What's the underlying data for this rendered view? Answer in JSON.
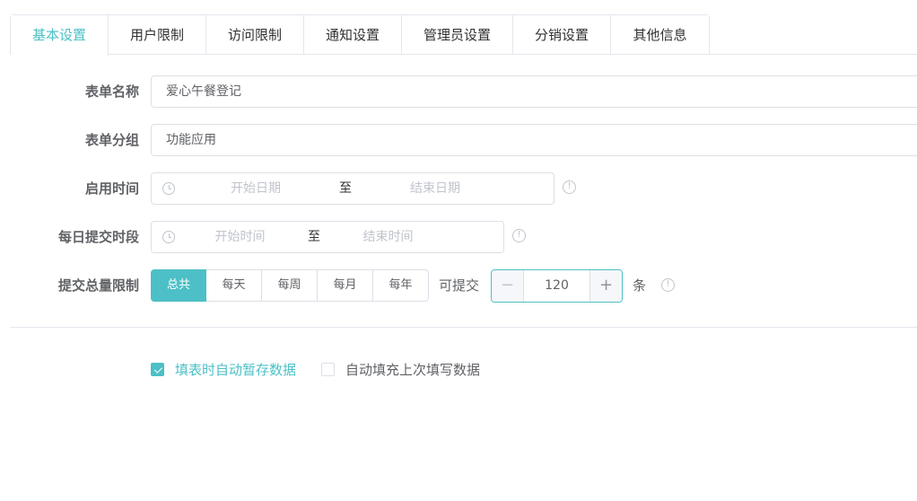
{
  "tabs": [
    {
      "label": "基本设置",
      "active": true
    },
    {
      "label": "用户限制"
    },
    {
      "label": "访问限制"
    },
    {
      "label": "通知设置"
    },
    {
      "label": "管理员设置"
    },
    {
      "label": "分销设置"
    },
    {
      "label": "其他信息"
    }
  ],
  "form": {
    "name_label": "表单名称",
    "name_value": "爱心午餐登记",
    "group_label": "表单分组",
    "group_value": "功能应用",
    "date_label": "启用时间",
    "date_start_placeholder": "开始日期",
    "date_end_placeholder": "结束日期",
    "range_sep": "至",
    "time_label": "每日提交时段",
    "time_start_placeholder": "开始时间",
    "time_end_placeholder": "结束时间",
    "limit_label": "提交总量限制",
    "limit_options": [
      "总共",
      "每天",
      "每周",
      "每月",
      "每年"
    ],
    "limit_selected": "总共",
    "can_submit_text": "可提交",
    "limit_value": "120",
    "unit_text": "条"
  },
  "checkboxes": [
    {
      "label": "填表时自动暂存数据",
      "checked": true
    },
    {
      "label": "自动填充上次填写数据",
      "checked": false
    }
  ],
  "colors": {
    "accent": "#4cc0c6",
    "border": "#dcdfe6",
    "text": "#606266",
    "placeholder": "#c0c4cc"
  }
}
